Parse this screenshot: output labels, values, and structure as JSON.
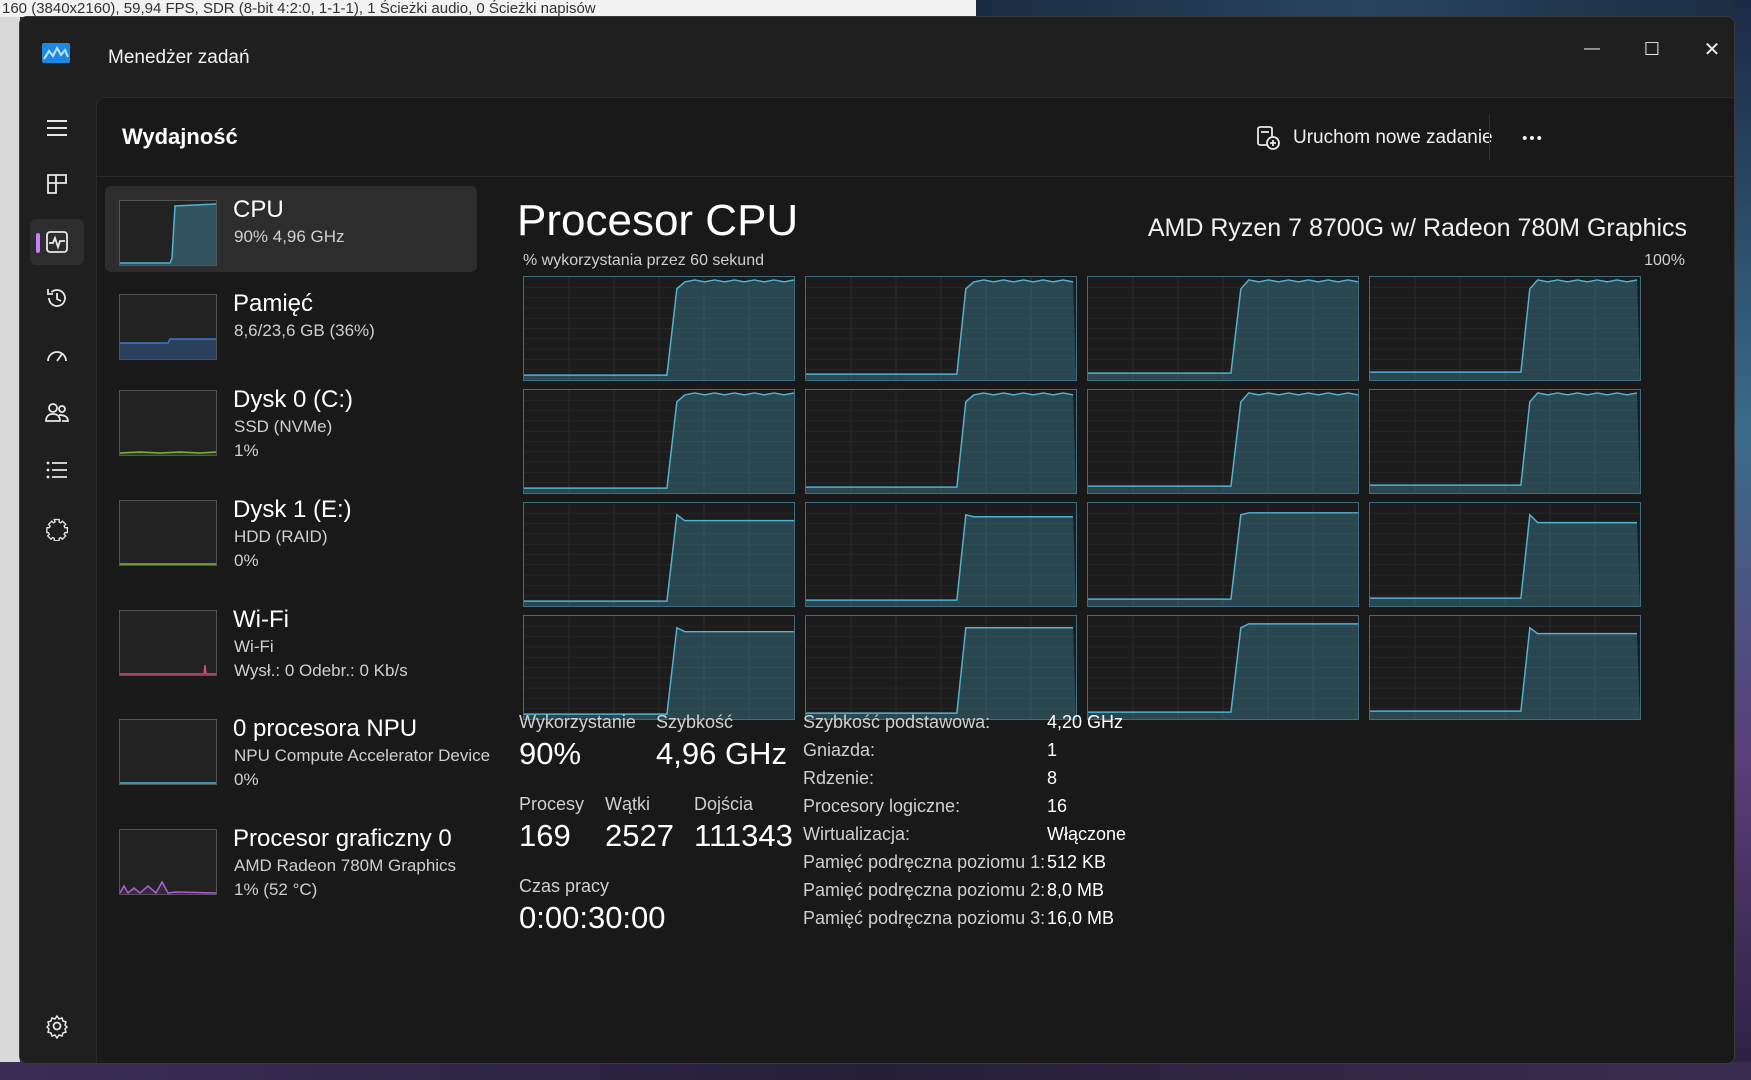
{
  "background": {
    "top_strip_text": "160 (3840x2160), 59,94 FPS, SDR (8-bit 4:2:0, 1-1-1), 1 Ścieżki audio, 0 Ścieżki napisów"
  },
  "window": {
    "title": "Menedżer zadań",
    "minimize_glyph": "—",
    "maximize_glyph": "☐",
    "close_glyph": "✕"
  },
  "header": {
    "title": "Wydajność",
    "run_task_label": "Uruchom nowe zadanie",
    "more_glyph": "•••"
  },
  "nav": {
    "items": [
      {
        "name": "hamburger-menu-icon"
      },
      {
        "name": "processes-icon"
      },
      {
        "name": "performance-icon",
        "active": true
      },
      {
        "name": "app-history-icon"
      },
      {
        "name": "startup-apps-icon"
      },
      {
        "name": "users-icon"
      },
      {
        "name": "details-icon"
      },
      {
        "name": "services-icon"
      }
    ],
    "settings": "settings-gear-icon",
    "accent_color": "#c77dff"
  },
  "devices": [
    {
      "name": "CPU",
      "line1": "90%  4,96 GHz",
      "line2": "",
      "selected": true,
      "color": "#4fb3d4"
    },
    {
      "name": "Pamięć",
      "line1": "8,6/23,6 GB (36%)",
      "line2": "",
      "color": "#3b79c9"
    },
    {
      "name": "Dysk 0 (C:)",
      "line1": "SSD (NVMe)",
      "line2": "1%",
      "color": "#7cb342"
    },
    {
      "name": "Dysk 1 (E:)",
      "line1": "HDD (RAID)",
      "line2": "0%",
      "color": "#7cb342"
    },
    {
      "name": "Wi-Fi",
      "line1": "Wi-Fi",
      "line2": "Wysł.: 0  Odebr.: 0 Kb/s",
      "color": "#d04a7a"
    },
    {
      "name": "0 procesora NPU",
      "line1": "NPU Compute Accelerator Device",
      "line2": "0%",
      "color": "#4fb3d4"
    },
    {
      "name": "Procesor graficzny 0",
      "line1": "AMD Radeon 780M Graphics",
      "line2": "1%  (52 °C)",
      "color": "#b05cd6"
    }
  ],
  "cpu": {
    "title": "Procesor CPU",
    "model": "AMD Ryzen 7 8700G w/ Radeon 780M Graphics",
    "graph_label": "% wykorzystania przez 60 sekund",
    "graph_max": "100%",
    "graph_color": "#4fb3d4",
    "cores": 16,
    "stats": {
      "utilization_label": "Wykorzystanie",
      "utilization": "90%",
      "speed_label": "Szybkość",
      "speed": "4,96 GHz",
      "processes_label": "Procesy",
      "processes": "169",
      "threads_label": "Wątki",
      "threads": "2527",
      "handles_label": "Dojścia",
      "handles": "111343",
      "uptime_label": "Czas pracy",
      "uptime": "0:00:30:00"
    },
    "specs": [
      {
        "label": "Szybkość podstawowa:",
        "value": "4,20 GHz"
      },
      {
        "label": "Gniazda:",
        "value": "1"
      },
      {
        "label": "Rdzenie:",
        "value": "8"
      },
      {
        "label": "Procesory logiczne:",
        "value": "16"
      },
      {
        "label": "Wirtualizacja:",
        "value": "Włączone"
      },
      {
        "label": "Pamięć podręczna poziomu 1:",
        "value": "512 KB"
      },
      {
        "label": "Pamięć podręczna poziomu 2:",
        "value": "8,0 MB"
      },
      {
        "label": "Pamięć podręczna poziomu 3:",
        "value": "16,0 MB"
      }
    ]
  }
}
